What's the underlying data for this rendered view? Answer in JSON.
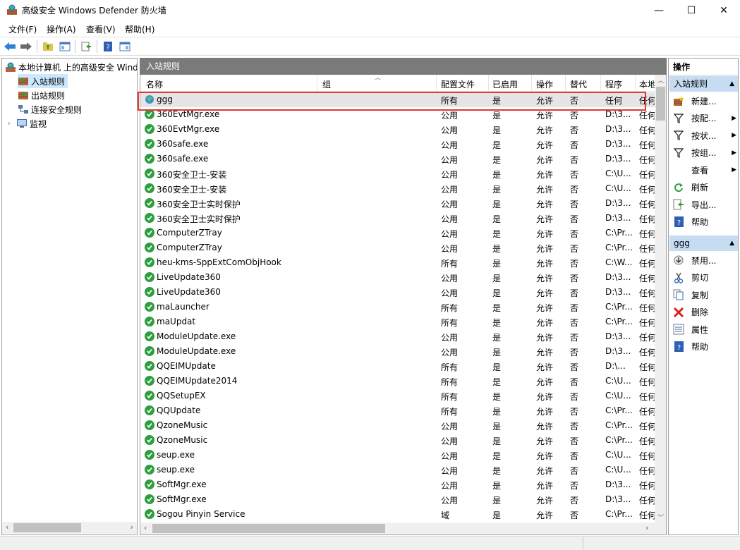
{
  "window": {
    "title": "高级安全 Windows Defender 防火墙",
    "min": "—",
    "max": "☐",
    "close": "✕"
  },
  "menu": [
    "文件(F)",
    "操作(A)",
    "查看(V)",
    "帮助(H)"
  ],
  "tree": {
    "root": "本地计算机 上的高级安全 Windows",
    "items": [
      "入站规则",
      "出站规则",
      "连接安全规则",
      "监视"
    ]
  },
  "center": {
    "header": "入站规则",
    "columns": [
      "名称",
      "组",
      "配置文件",
      "已启用",
      "操作",
      "替代",
      "程序",
      "本地"
    ]
  },
  "rows": [
    {
      "name": "ggg",
      "profile": "所有",
      "enabled": "是",
      "action": "允许",
      "override": "否",
      "program": "任何",
      "local": "任何"
    },
    {
      "name": "360EvtMgr.exe",
      "profile": "公用",
      "enabled": "是",
      "action": "允许",
      "override": "否",
      "program": "D:\\3...",
      "local": "任何"
    },
    {
      "name": "360EvtMgr.exe",
      "profile": "公用",
      "enabled": "是",
      "action": "允许",
      "override": "否",
      "program": "D:\\3...",
      "local": "任何"
    },
    {
      "name": "360safe.exe",
      "profile": "公用",
      "enabled": "是",
      "action": "允许",
      "override": "否",
      "program": "D:\\3...",
      "local": "任何"
    },
    {
      "name": "360safe.exe",
      "profile": "公用",
      "enabled": "是",
      "action": "允许",
      "override": "否",
      "program": "D:\\3...",
      "local": "任何"
    },
    {
      "name": "360安全卫士-安装",
      "profile": "公用",
      "enabled": "是",
      "action": "允许",
      "override": "否",
      "program": "C:\\U...",
      "local": "任何"
    },
    {
      "name": "360安全卫士-安装",
      "profile": "公用",
      "enabled": "是",
      "action": "允许",
      "override": "否",
      "program": "C:\\U...",
      "local": "任何"
    },
    {
      "name": "360安全卫士实时保护",
      "profile": "公用",
      "enabled": "是",
      "action": "允许",
      "override": "否",
      "program": "D:\\3...",
      "local": "任何"
    },
    {
      "name": "360安全卫士实时保护",
      "profile": "公用",
      "enabled": "是",
      "action": "允许",
      "override": "否",
      "program": "D:\\3...",
      "local": "任何"
    },
    {
      "name": "ComputerZTray",
      "profile": "公用",
      "enabled": "是",
      "action": "允许",
      "override": "否",
      "program": "C:\\Pr...",
      "local": "任何"
    },
    {
      "name": "ComputerZTray",
      "profile": "公用",
      "enabled": "是",
      "action": "允许",
      "override": "否",
      "program": "C:\\Pr...",
      "local": "任何"
    },
    {
      "name": "heu-kms-SppExtComObjHook",
      "profile": "所有",
      "enabled": "是",
      "action": "允许",
      "override": "否",
      "program": "C:\\W...",
      "local": "任何"
    },
    {
      "name": "LiveUpdate360",
      "profile": "公用",
      "enabled": "是",
      "action": "允许",
      "override": "否",
      "program": "D:\\3...",
      "local": "任何"
    },
    {
      "name": "LiveUpdate360",
      "profile": "公用",
      "enabled": "是",
      "action": "允许",
      "override": "否",
      "program": "D:\\3...",
      "local": "任何"
    },
    {
      "name": "maLauncher",
      "profile": "所有",
      "enabled": "是",
      "action": "允许",
      "override": "否",
      "program": "C:\\Pr...",
      "local": "任何"
    },
    {
      "name": "maUpdat",
      "profile": "所有",
      "enabled": "是",
      "action": "允许",
      "override": "否",
      "program": "C:\\Pr...",
      "local": "任何"
    },
    {
      "name": "ModuleUpdate.exe",
      "profile": "公用",
      "enabled": "是",
      "action": "允许",
      "override": "否",
      "program": "D:\\3...",
      "local": "任何"
    },
    {
      "name": "ModuleUpdate.exe",
      "profile": "公用",
      "enabled": "是",
      "action": "允许",
      "override": "否",
      "program": "D:\\3...",
      "local": "任何"
    },
    {
      "name": "QQEIMUpdate",
      "profile": "所有",
      "enabled": "是",
      "action": "允许",
      "override": "否",
      "program": "D:\\...",
      "local": "任何"
    },
    {
      "name": "QQEIMUpdate2014",
      "profile": "所有",
      "enabled": "是",
      "action": "允许",
      "override": "否",
      "program": "C:\\U...",
      "local": "任何"
    },
    {
      "name": "QQSetupEX",
      "profile": "所有",
      "enabled": "是",
      "action": "允许",
      "override": "否",
      "program": "C:\\U...",
      "local": "任何"
    },
    {
      "name": "QQUpdate",
      "profile": "所有",
      "enabled": "是",
      "action": "允许",
      "override": "否",
      "program": "C:\\Pr...",
      "local": "任何"
    },
    {
      "name": "QzoneMusic",
      "profile": "公用",
      "enabled": "是",
      "action": "允许",
      "override": "否",
      "program": "C:\\Pr...",
      "local": "任何"
    },
    {
      "name": "QzoneMusic",
      "profile": "公用",
      "enabled": "是",
      "action": "允许",
      "override": "否",
      "program": "C:\\Pr...",
      "local": "任何"
    },
    {
      "name": "seup.exe",
      "profile": "公用",
      "enabled": "是",
      "action": "允许",
      "override": "否",
      "program": "C:\\U...",
      "local": "任何"
    },
    {
      "name": "seup.exe",
      "profile": "公用",
      "enabled": "是",
      "action": "允许",
      "override": "否",
      "program": "C:\\U...",
      "local": "任何"
    },
    {
      "name": "SoftMgr.exe",
      "profile": "公用",
      "enabled": "是",
      "action": "允许",
      "override": "否",
      "program": "D:\\3...",
      "local": "任何"
    },
    {
      "name": "SoftMgr.exe",
      "profile": "公用",
      "enabled": "是",
      "action": "允许",
      "override": "否",
      "program": "D:\\3...",
      "local": "任何"
    },
    {
      "name": "Sogou Pinyin Service",
      "profile": "域",
      "enabled": "是",
      "action": "允许",
      "override": "否",
      "program": "C:\\Pr...",
      "local": "任何"
    }
  ],
  "actions": {
    "title": "操作",
    "section1": "入站规则",
    "items1": [
      {
        "label": "新建...",
        "icon": "new-rule-icon",
        "arrow": ""
      },
      {
        "label": "按配...",
        "icon": "filter-icon",
        "arrow": "▶"
      },
      {
        "label": "按状...",
        "icon": "filter-icon",
        "arrow": "▶"
      },
      {
        "label": "按组...",
        "icon": "filter-icon",
        "arrow": "▶"
      },
      {
        "label": "查看",
        "icon": "",
        "arrow": "▶"
      },
      {
        "label": "刷新",
        "icon": "refresh-icon",
        "arrow": ""
      },
      {
        "label": "导出...",
        "icon": "export-icon",
        "arrow": ""
      },
      {
        "label": "帮助",
        "icon": "help-icon",
        "arrow": ""
      }
    ],
    "section2": "ggg",
    "items2": [
      {
        "label": "禁用...",
        "icon": "disable-icon"
      },
      {
        "label": "剪切",
        "icon": "cut-icon"
      },
      {
        "label": "复制",
        "icon": "copy-icon"
      },
      {
        "label": "删除",
        "icon": "delete-icon"
      },
      {
        "label": "属性",
        "icon": "properties-icon"
      },
      {
        "label": "帮助",
        "icon": "help-icon"
      }
    ]
  },
  "colors": {
    "selection": "#cce8ff",
    "section": "#c6dcf2",
    "header_bar": "#7a7a7a",
    "highlight": "#e53935",
    "check_green": "#2e9e3e"
  }
}
